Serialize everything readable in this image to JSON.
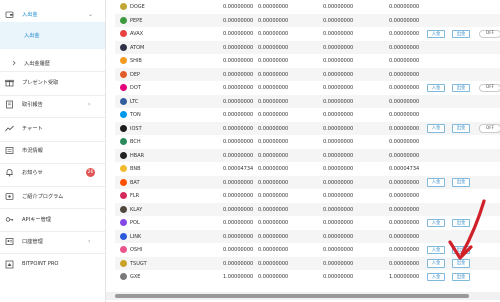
{
  "sidebar": {
    "items": [
      {
        "label": "入出金",
        "icon": "wallet-icon"
      },
      {
        "label": "入出金",
        "icon": ""
      },
      {
        "label": "入出金履歴",
        "icon": "chevron-right-icon"
      },
      {
        "label": "プレゼント受取",
        "icon": "gift-icon"
      },
      {
        "label": "取引報告",
        "icon": "document-icon"
      },
      {
        "label": "チャート",
        "icon": "chart-icon"
      },
      {
        "label": "市況情報",
        "icon": "newspaper-icon"
      },
      {
        "label": "お知らせ",
        "icon": "bell-icon"
      },
      {
        "label": "ご紹介プログラム",
        "icon": "referral-icon"
      },
      {
        "label": "APIキー管理",
        "icon": "key-icon"
      },
      {
        "label": "口座管理",
        "icon": "user-icon"
      },
      {
        "label": "BITPOINT PRO",
        "icon": "pro-icon"
      }
    ],
    "notification_badge": "26"
  },
  "buttons": {
    "deposit": "入金",
    "withdraw": "出金",
    "off": "OFF"
  },
  "table": {
    "rows": [
      {
        "coin": "DOGE",
        "color": "#c2a633",
        "v1": "0.00000000",
        "v2": "0.00000000",
        "v3": "0.00000000",
        "v4": "0.00000000",
        "actions": false,
        "off": false
      },
      {
        "coin": "PEPE",
        "color": "#3d9a3d",
        "v1": "0.00000000",
        "v2": "0.00000000",
        "v3": "0.00000000",
        "v4": "0.00000000",
        "actions": false,
        "off": false
      },
      {
        "coin": "AVAX",
        "color": "#e84142",
        "v1": "0.00000000",
        "v2": "0.00000000",
        "v3": "0.00000000",
        "v4": "0.00000000",
        "actions": true,
        "off": true
      },
      {
        "coin": "ATOM",
        "color": "#2e3148",
        "v1": "0.00000000",
        "v2": "0.00000000",
        "v3": "0.00000000",
        "v4": "0.00000000",
        "actions": false,
        "off": false
      },
      {
        "coin": "SHIB",
        "color": "#f29a1f",
        "v1": "0.00000000",
        "v2": "0.00000000",
        "v3": "0.00000000",
        "v4": "0.00000000",
        "actions": false,
        "off": false
      },
      {
        "coin": "DEP",
        "color": "#e25c2a",
        "v1": "0.00000000",
        "v2": "0.00000000",
        "v3": "0.00000000",
        "v4": "0.00000000",
        "actions": false,
        "off": false
      },
      {
        "coin": "DOT",
        "color": "#e6007a",
        "v1": "0.00000000",
        "v2": "0.00000000",
        "v3": "0.00000000",
        "v4": "0.00000000",
        "actions": true,
        "off": true
      },
      {
        "coin": "LTC",
        "color": "#345d9d",
        "v1": "0.00000000",
        "v2": "0.00000000",
        "v3": "0.00000000",
        "v4": "0.00000000",
        "actions": false,
        "off": false
      },
      {
        "coin": "TON",
        "color": "#0098ea",
        "v1": "0.00000000",
        "v2": "0.00000000",
        "v3": "0.00000000",
        "v4": "0.00000000",
        "actions": false,
        "off": false
      },
      {
        "coin": "IOST",
        "color": "#1c1c1c",
        "v1": "0.00000000",
        "v2": "0.00000000",
        "v3": "0.00000000",
        "v4": "0.00000000",
        "actions": true,
        "off": true
      },
      {
        "coin": "BCH",
        "color": "#2b8a5a",
        "v1": "0.00000000",
        "v2": "0.00000000",
        "v3": "0.00000000",
        "v4": "0.00000000",
        "actions": false,
        "off": false
      },
      {
        "coin": "HBAR",
        "color": "#222222",
        "v1": "0.00000000",
        "v2": "0.00000000",
        "v3": "0.00000000",
        "v4": "0.00000000",
        "actions": false,
        "off": false
      },
      {
        "coin": "BNB",
        "color": "#f3ba2f",
        "v1": "0.00004734",
        "v2": "0.00000000",
        "v3": "0.00000000",
        "v4": "0.00004734",
        "actions": false,
        "off": false
      },
      {
        "coin": "BAT",
        "color": "#ff5000",
        "v1": "0.00000000",
        "v2": "0.00000000",
        "v3": "0.00000000",
        "v4": "0.00000000",
        "actions": true,
        "off": false
      },
      {
        "coin": "FLR",
        "color": "#d42a5b",
        "v1": "0.00000000",
        "v2": "0.00000000",
        "v3": "0.00000000",
        "v4": "0.00000000",
        "actions": false,
        "off": false
      },
      {
        "coin": "KLAY",
        "color": "#4f473b",
        "v1": "0.00000000",
        "v2": "0.00000000",
        "v3": "0.00000000",
        "v4": "0.00000000",
        "actions": false,
        "off": false
      },
      {
        "coin": "POL",
        "color": "#8247e5",
        "v1": "0.00000000",
        "v2": "0.00000000",
        "v3": "0.00000000",
        "v4": "0.00000000",
        "actions": true,
        "off": false
      },
      {
        "coin": "LINK",
        "color": "#2a5ada",
        "v1": "0.00000000",
        "v2": "0.00000000",
        "v3": "0.00000000",
        "v4": "0.00000000",
        "actions": false,
        "off": false
      },
      {
        "coin": "OSHI",
        "color": "#e8548b",
        "v1": "0.00000000",
        "v2": "0.00000000",
        "v3": "0.00000000",
        "v4": "0.00000000",
        "actions": true,
        "off": false
      },
      {
        "coin": "TSUGT",
        "color": "#c9a227",
        "v1": "0.00000000",
        "v2": "0.00000000",
        "v3": "0.00000000",
        "v4": "0.00000000",
        "actions": true,
        "off": false
      },
      {
        "coin": "GXE",
        "color": "#7a7a7a",
        "v1": "1.00000000",
        "v2": "0.00000000",
        "v3": "0.00000000",
        "v4": "1.00000000",
        "actions": true,
        "off": false
      }
    ]
  },
  "colors": {
    "accent": "#1a8bd0",
    "button_border": "#7fb9de",
    "annotation_arrow": "#d0202a"
  }
}
